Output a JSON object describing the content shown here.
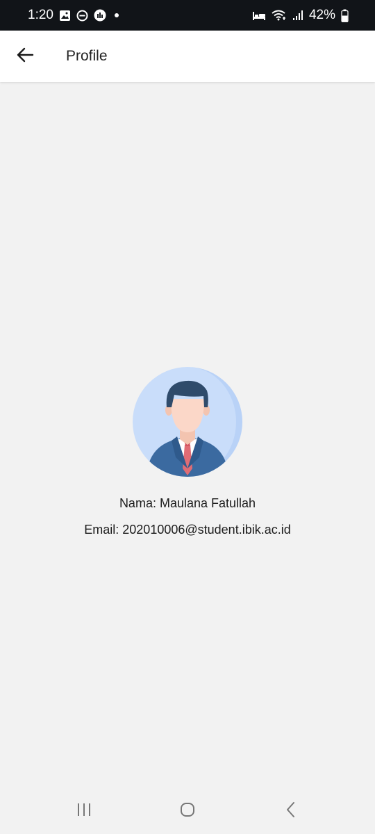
{
  "status_bar": {
    "time": "1:20",
    "battery_percent": "42%",
    "left_icons": [
      "gallery-icon",
      "dnd-icon",
      "voice-icon",
      "notification-dot"
    ],
    "right_icons": [
      "sleep-mode-icon",
      "wifi-icon",
      "signal-icon",
      "battery-icon"
    ]
  },
  "app_bar": {
    "title": "Profile",
    "back_icon": "arrow-left-icon"
  },
  "profile": {
    "avatar_icon": "businessman-avatar-icon",
    "name_line": "Nama: Maulana Fatullah",
    "email_line": "Email: 202010006@student.ibik.ac.id"
  },
  "nav_bar": {
    "icons": [
      "recent-apps-icon",
      "home-icon",
      "back-icon"
    ]
  },
  "colors": {
    "status_bar_bg": "#111418",
    "app_bar_bg": "#ffffff",
    "page_bg": "#f2f2f2",
    "avatar_bg": "#c9ddfa"
  }
}
